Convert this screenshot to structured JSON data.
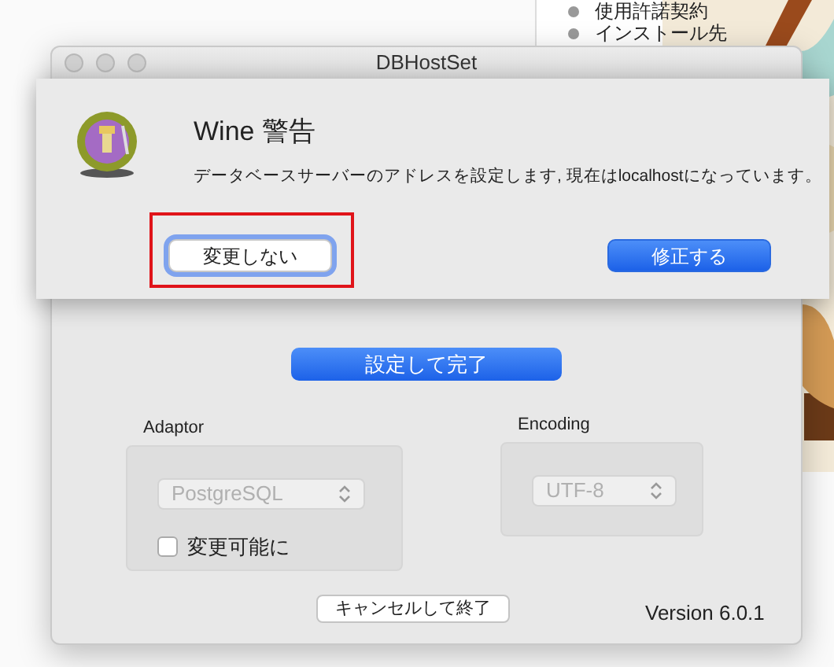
{
  "background_window": {
    "items": [
      "使用許諾契約",
      "インストール先"
    ]
  },
  "window": {
    "title": "DBHostSet",
    "primary_button": "設定して完了",
    "adaptor": {
      "label": "Adaptor",
      "value": "PostgreSQL",
      "disabled": true,
      "checkbox": {
        "label": "変更可能に",
        "checked": false
      }
    },
    "encoding": {
      "label": "Encoding",
      "value": "UTF-8",
      "disabled": true
    },
    "cancel_button": "キャンセルして終了",
    "version": "Version 6.0.1"
  },
  "alert": {
    "title": "Wine 警告",
    "message": "データベースサーバーのアドレスを設定します, 現在はlocalhostになっています。",
    "buttons": [
      {
        "label": "変更しない",
        "kind": "default",
        "focused": true
      },
      {
        "label": "修正する",
        "kind": "primary",
        "focused": false
      }
    ]
  }
}
